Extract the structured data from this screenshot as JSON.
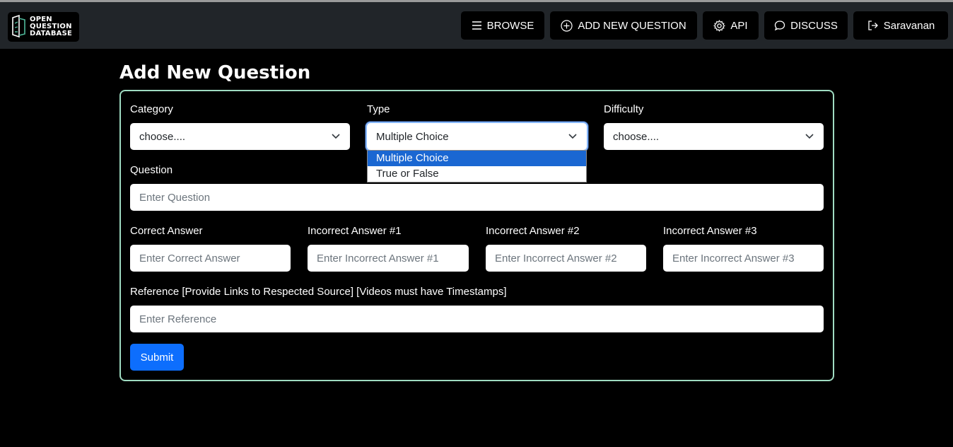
{
  "logo": {
    "line1": "OPEN",
    "line2": "QUESTION",
    "line3": "DATABASE"
  },
  "nav": {
    "browse": {
      "label": "BROWSE",
      "icon": "list-icon"
    },
    "add_new_question": {
      "label": "ADD NEW QUESTION",
      "icon": "plus-circle-icon"
    },
    "api": {
      "label": "API",
      "icon": "gear-icon"
    },
    "discuss": {
      "label": "DISCUSS",
      "icon": "chat-bubble-icon"
    },
    "user": {
      "label": "Saravanan",
      "icon": "logout-icon"
    }
  },
  "page": {
    "title": "Add New Question"
  },
  "form": {
    "category": {
      "label": "Category",
      "value": "choose...."
    },
    "type": {
      "label": "Type",
      "value": "Multiple Choice",
      "options": [
        "Multiple Choice",
        "True or False"
      ],
      "expanded": true
    },
    "difficulty": {
      "label": "Difficulty",
      "value": "choose...."
    },
    "question": {
      "label": "Question",
      "placeholder": "Enter Question"
    },
    "correct_answer": {
      "label": "Correct Answer",
      "placeholder": "Enter Correct Answer"
    },
    "incorrect_1": {
      "label": "Incorrect Answer #1",
      "placeholder": "Enter Incorrect Answer #1"
    },
    "incorrect_2": {
      "label": "Incorrect Answer #2",
      "placeholder": "Enter Incorrect Answer #2"
    },
    "incorrect_3": {
      "label": "Incorrect Answer #3",
      "placeholder": "Enter Incorrect Answer #3"
    },
    "reference": {
      "label": "Reference [Provide Links to Respected Source] [Videos must have Timestamps]",
      "placeholder": "Enter Reference"
    },
    "submit_label": "Submit"
  },
  "colors": {
    "navbar_bg": "#212529",
    "page_bg": "#000000",
    "card_border": "#9fdcc2",
    "primary": "#0d6efd",
    "dropdown_highlight": "#1a67d2"
  }
}
